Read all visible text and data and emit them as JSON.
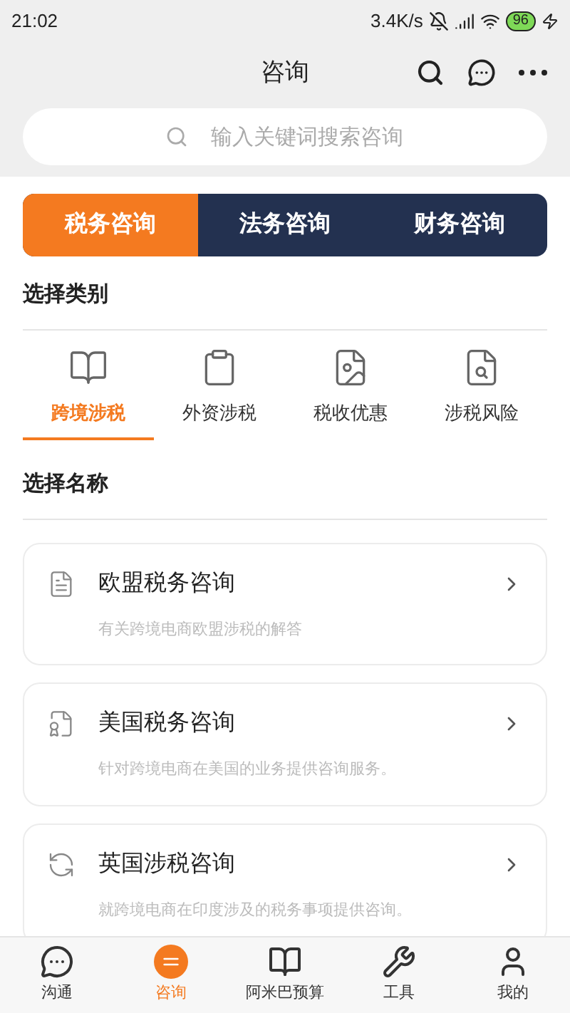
{
  "status_bar": {
    "time": "21:02",
    "speed": "3.4K/s",
    "battery": "96"
  },
  "header": {
    "title": "咨询"
  },
  "search": {
    "placeholder": "输入关键词搜索咨询"
  },
  "tabs": [
    {
      "label": "税务咨询",
      "selected": true
    },
    {
      "label": "法务咨询",
      "selected": false
    },
    {
      "label": "财务咨询",
      "selected": false
    }
  ],
  "category_heading": "选择类别",
  "categories": [
    {
      "label": "跨境涉税",
      "selected": true
    },
    {
      "label": "外资涉税",
      "selected": false
    },
    {
      "label": "税收优惠",
      "selected": false
    },
    {
      "label": "涉税风险",
      "selected": false
    }
  ],
  "name_heading": "选择名称",
  "items": [
    {
      "title": "欧盟税务咨询",
      "description": "有关跨境电商欧盟涉税的解答"
    },
    {
      "title": "美国税务咨询",
      "description": "针对跨境电商在美国的业务提供咨询服务。"
    },
    {
      "title": "英国涉税咨询",
      "description": "就跨境电商在印度涉及的税务事项提供咨询。"
    }
  ],
  "bottom_nav": [
    {
      "label": "沟通",
      "selected": false
    },
    {
      "label": "咨询",
      "selected": true
    },
    {
      "label": "阿米巴预算",
      "selected": false
    },
    {
      "label": "工具",
      "selected": false
    },
    {
      "label": "我的",
      "selected": false
    }
  ]
}
